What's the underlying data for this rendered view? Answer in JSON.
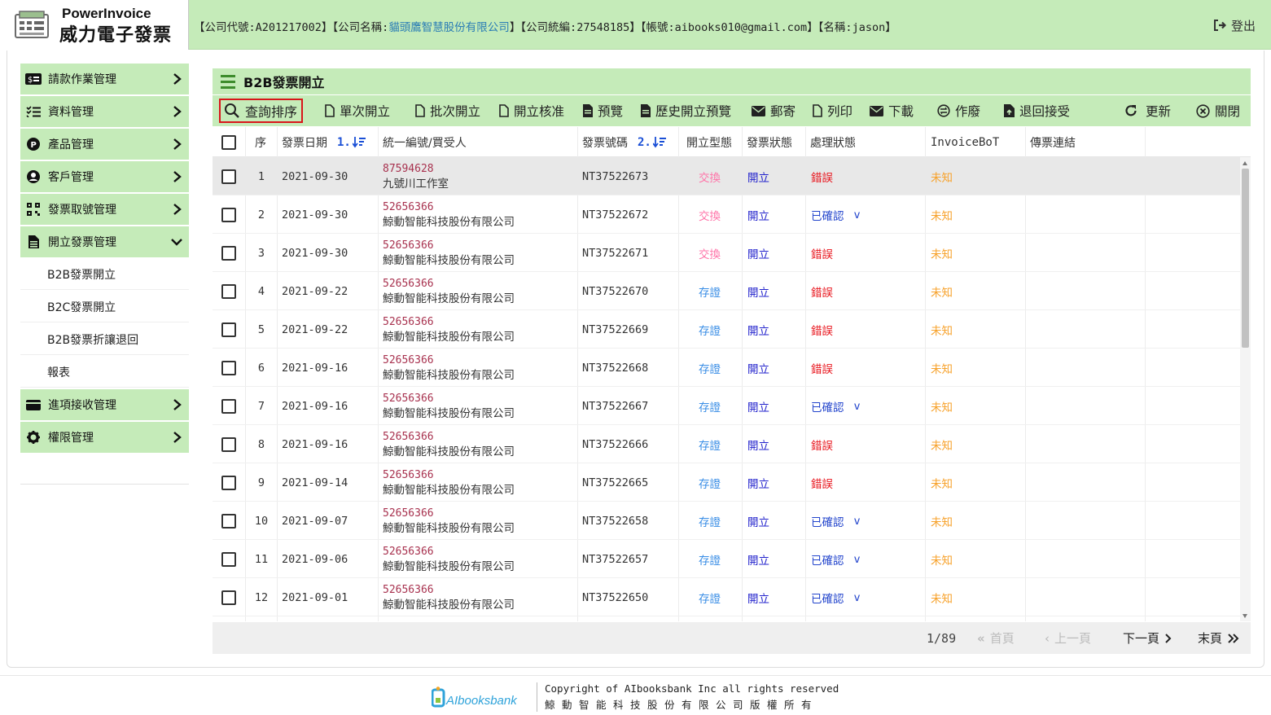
{
  "header": {
    "logo_en": "PowerInvoice",
    "logo_zh": "威力電子發票",
    "company_code_label": "【公司代號:",
    "company_code": "A201217002",
    "company_name_label": "】【公司名稱:",
    "company_name": "貓頭鷹智慧股份有限公司",
    "tax_id_label": "】【公司統編:",
    "tax_id": "27548185",
    "account_label": "】【帳號:",
    "account": "aibooks010@gmail.com",
    "name_label": "】【名稱:",
    "name": "jason",
    "name_close": "】",
    "logout": "登出"
  },
  "sidebar": {
    "items": [
      {
        "label": "請款作業管理",
        "icon": "billing-icon"
      },
      {
        "label": "資料管理",
        "icon": "list-check-icon"
      },
      {
        "label": "產品管理",
        "icon": "product-icon"
      },
      {
        "label": "客戶管理",
        "icon": "user-icon"
      },
      {
        "label": "發票取號管理",
        "icon": "qrcode-icon"
      },
      {
        "label": "開立發票管理",
        "icon": "document-icon"
      }
    ],
    "sub_items": [
      "B2B發票開立",
      "B2C發票開立",
      "B2B發票折讓退回",
      "報表"
    ],
    "items_after": [
      {
        "label": "進項接收管理",
        "icon": "wallet-icon"
      },
      {
        "label": "權限管理",
        "icon": "gear-icon"
      }
    ]
  },
  "main": {
    "title": "B2B發票開立",
    "toolbar": {
      "query": "查詢排序",
      "single": "單次開立",
      "batch": "批次開立",
      "approve": "開立核准",
      "preview": "預覽",
      "history": "歷史開立預覽",
      "mail": "郵寄",
      "print": "列印",
      "download": "下載",
      "void": "作廢",
      "return": "退回接受",
      "refresh": "更新",
      "close": "關閉"
    },
    "columns": {
      "seq": "序",
      "date": "發票日期",
      "date_sort": "1.",
      "buyer": "統一編號/買受人",
      "number": "發票號碼",
      "number_sort": "2.",
      "type": "開立型態",
      "status": "發票狀態",
      "process": "處理狀態",
      "bot": "InvoiceBoT",
      "link": "傳票連結"
    },
    "rows": [
      {
        "seq": "1",
        "date": "2021-09-30",
        "buyer_id": "87594628",
        "buyer_name": "九號川工作室",
        "number": "NT37522673",
        "type": "交換",
        "status": "開立",
        "process": "錯誤",
        "bot": "未知"
      },
      {
        "seq": "2",
        "date": "2021-09-30",
        "buyer_id": "52656366",
        "buyer_name": "鯨動智能科技股份有限公司",
        "number": "NT37522672",
        "type": "交換",
        "status": "開立",
        "process": "已確認",
        "process_v": "v",
        "bot": "未知"
      },
      {
        "seq": "3",
        "date": "2021-09-30",
        "buyer_id": "52656366",
        "buyer_name": "鯨動智能科技股份有限公司",
        "number": "NT37522671",
        "type": "交換",
        "status": "開立",
        "process": "錯誤",
        "bot": "未知"
      },
      {
        "seq": "4",
        "date": "2021-09-22",
        "buyer_id": "52656366",
        "buyer_name": "鯨動智能科技股份有限公司",
        "number": "NT37522670",
        "type": "存證",
        "status": "開立",
        "process": "錯誤",
        "bot": "未知"
      },
      {
        "seq": "5",
        "date": "2021-09-22",
        "buyer_id": "52656366",
        "buyer_name": "鯨動智能科技股份有限公司",
        "number": "NT37522669",
        "type": "存證",
        "status": "開立",
        "process": "錯誤",
        "bot": "未知"
      },
      {
        "seq": "6",
        "date": "2021-09-16",
        "buyer_id": "52656366",
        "buyer_name": "鯨動智能科技股份有限公司",
        "number": "NT37522668",
        "type": "存證",
        "status": "開立",
        "process": "錯誤",
        "bot": "未知"
      },
      {
        "seq": "7",
        "date": "2021-09-16",
        "buyer_id": "52656366",
        "buyer_name": "鯨動智能科技股份有限公司",
        "number": "NT37522667",
        "type": "存證",
        "status": "開立",
        "process": "已確認",
        "process_v": "v",
        "bot": "未知"
      },
      {
        "seq": "8",
        "date": "2021-09-16",
        "buyer_id": "52656366",
        "buyer_name": "鯨動智能科技股份有限公司",
        "number": "NT37522666",
        "type": "存證",
        "status": "開立",
        "process": "錯誤",
        "bot": "未知"
      },
      {
        "seq": "9",
        "date": "2021-09-14",
        "buyer_id": "52656366",
        "buyer_name": "鯨動智能科技股份有限公司",
        "number": "NT37522665",
        "type": "存證",
        "status": "開立",
        "process": "錯誤",
        "bot": "未知"
      },
      {
        "seq": "10",
        "date": "2021-09-07",
        "buyer_id": "52656366",
        "buyer_name": "鯨動智能科技股份有限公司",
        "number": "NT37522658",
        "type": "存證",
        "status": "開立",
        "process": "已確認",
        "process_v": "v",
        "bot": "未知"
      },
      {
        "seq": "11",
        "date": "2021-09-06",
        "buyer_id": "52656366",
        "buyer_name": "鯨動智能科技股份有限公司",
        "number": "NT37522657",
        "type": "存證",
        "status": "開立",
        "process": "已確認",
        "process_v": "v",
        "bot": "未知"
      },
      {
        "seq": "12",
        "date": "2021-09-01",
        "buyer_id": "52656366",
        "buyer_name": "鯨動智能科技股份有限公司",
        "number": "NT37522650",
        "type": "存證",
        "status": "開立",
        "process": "已確認",
        "process_v": "v",
        "bot": "未知"
      }
    ],
    "pager": {
      "page": "1/89",
      "first": "首頁",
      "prev": "上一頁",
      "next": "下一頁",
      "last": "末頁"
    }
  },
  "footer": {
    "logo_text": "AIbooksbank",
    "copyright": "Copyright of AIbooksbank Inc all rights reserved",
    "copyright_zh": "鯨動智能科技股份有限公司版權所有"
  },
  "colors": {
    "accent_green": "#c5ebb9",
    "error_red": "#e8141c",
    "unknown_orange": "#f7a22c",
    "swap_pink": "#ff73a8",
    "store_blue": "#3a8ee6"
  }
}
